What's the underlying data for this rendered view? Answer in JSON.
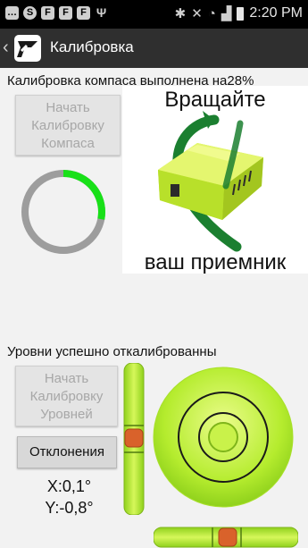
{
  "status_bar": {
    "left_icons": [
      {
        "name": "message-icon",
        "glyph": "…"
      },
      {
        "name": "skype-icon",
        "glyph": "S"
      },
      {
        "name": "flipboard-icon",
        "glyph": "F"
      },
      {
        "name": "flipboard-icon",
        "glyph": "F"
      },
      {
        "name": "flipboard-icon",
        "glyph": "F"
      },
      {
        "name": "usb-icon",
        "glyph": "Ψ"
      }
    ],
    "time": "2:20 PM"
  },
  "action_bar": {
    "title": "Калибровка"
  },
  "compass": {
    "status": "Калибровка компаса выполнена на28%",
    "start_button": [
      "Начать",
      "Калибровку",
      "Компаса"
    ],
    "progress": 0.28,
    "illustration_top": "Вращайте",
    "illustration_bottom": "ваш приемник"
  },
  "levels": {
    "status": "Уровни успешно откалиброванны",
    "start_button": [
      "Начать",
      "Калибровку",
      "Уровней"
    ],
    "deviations_button": "Отклонения",
    "x_reading": "X:0,1°",
    "y_reading": "Y:-0,8°"
  },
  "colors": {
    "accent_green": "#18e018",
    "level_green": "#b5ec2e",
    "bubble_orange": "#d9622b",
    "action_bar": "#2f2f2f"
  }
}
